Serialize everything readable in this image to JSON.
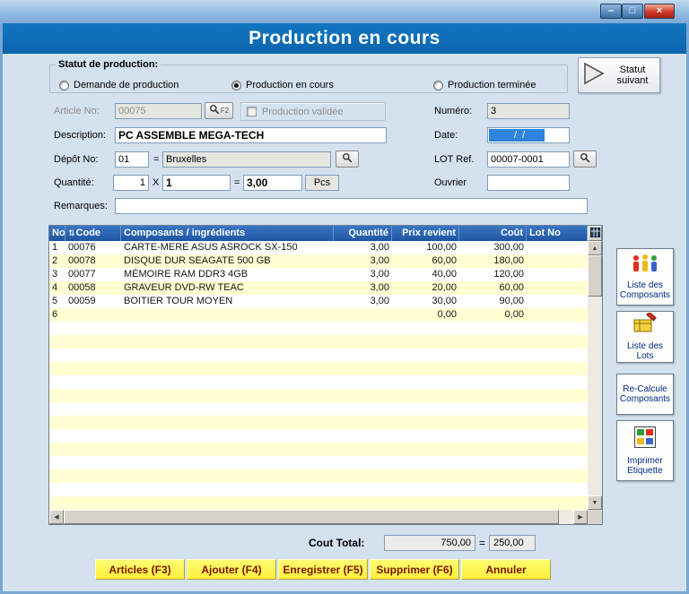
{
  "window": {
    "title": "Production en cours",
    "controls": {
      "minimize": "–",
      "maximize": "□",
      "close": "×"
    }
  },
  "status": {
    "group_label": "Statut de production:",
    "options": [
      {
        "label": "Demande de production",
        "selected": false
      },
      {
        "label": "Production en cours",
        "selected": true
      },
      {
        "label": "Production terminée",
        "selected": false
      }
    ],
    "next_button_label": "Statut suivant"
  },
  "form": {
    "article_label": "Article No:",
    "article_value": "00075",
    "article_f2": "F2",
    "validated_label": "Production validée",
    "numero_label": "Numéro:",
    "numero_value": "3",
    "description_label": "Description:",
    "description_value": "PC ASSEMBLE MEGA-TECH",
    "date_label": "Date:",
    "date_mask": "  /  /",
    "depot_label": "Dépôt  No:",
    "depot_value": "01",
    "depot_equals": "=",
    "depot_name": "Bruxelles",
    "lot_label": "LOT Ref.",
    "lot_value": "00007-0001",
    "qty_label": "Quantité:",
    "qty_v1": "1",
    "qty_x": "X",
    "qty_v2": "1",
    "qty_equals": "=",
    "qty_total": "3,00",
    "qty_unit": "Pcs",
    "ouvrier_label": "Ouvrier",
    "ouvrier_value": "",
    "remarques_label": "Remarques:",
    "remarques_value": ""
  },
  "table": {
    "sort_glyph": "⇅",
    "columns": [
      "No",
      "Code",
      "Composants / ingrédients",
      "Quantité",
      "Prix revient",
      "Coût",
      "Lot No"
    ],
    "rows": [
      [
        "1",
        "00076",
        "CARTE-MERE ASUS ASROCK SX-150",
        "3,00",
        "100,00",
        "300,00",
        ""
      ],
      [
        "2",
        "00078",
        "DISQUE DUR SEAGATE 500 GB",
        "3,00",
        "60,00",
        "180,00",
        ""
      ],
      [
        "3",
        "00077",
        "MÉMOIRE RAM DDR3 4GB",
        "3,00",
        "40,00",
        "120,00",
        ""
      ],
      [
        "4",
        "00058",
        "GRAVEUR DVD-RW TEAC",
        "3,00",
        "20,00",
        "60,00",
        ""
      ],
      [
        "5",
        "00059",
        "BOITIER TOUR MOYEN",
        "3,00",
        "30,00",
        "90,00",
        ""
      ],
      [
        "6",
        "",
        "",
        "",
        "0,00",
        "0,00",
        ""
      ]
    ],
    "visible_rows": 20
  },
  "side_buttons": {
    "composants": "Liste des Composants",
    "lots": "Liste des Lots",
    "recalcule": "Re-Calcule Composants",
    "etiquette": "Imprimer Etiquette"
  },
  "footer": {
    "total_label": "Cout Total:",
    "total_value": "750,00",
    "equals": "=",
    "unit_value": "250,00",
    "buttons": [
      "Articles (F3)",
      "Ajouter  (F4)",
      "Enregistrer (F5)",
      "Supprimer (F6)",
      "Annuler"
    ]
  },
  "scrollbar": {
    "up": "▲",
    "down": "▼",
    "left": "◀",
    "right": "▶"
  }
}
